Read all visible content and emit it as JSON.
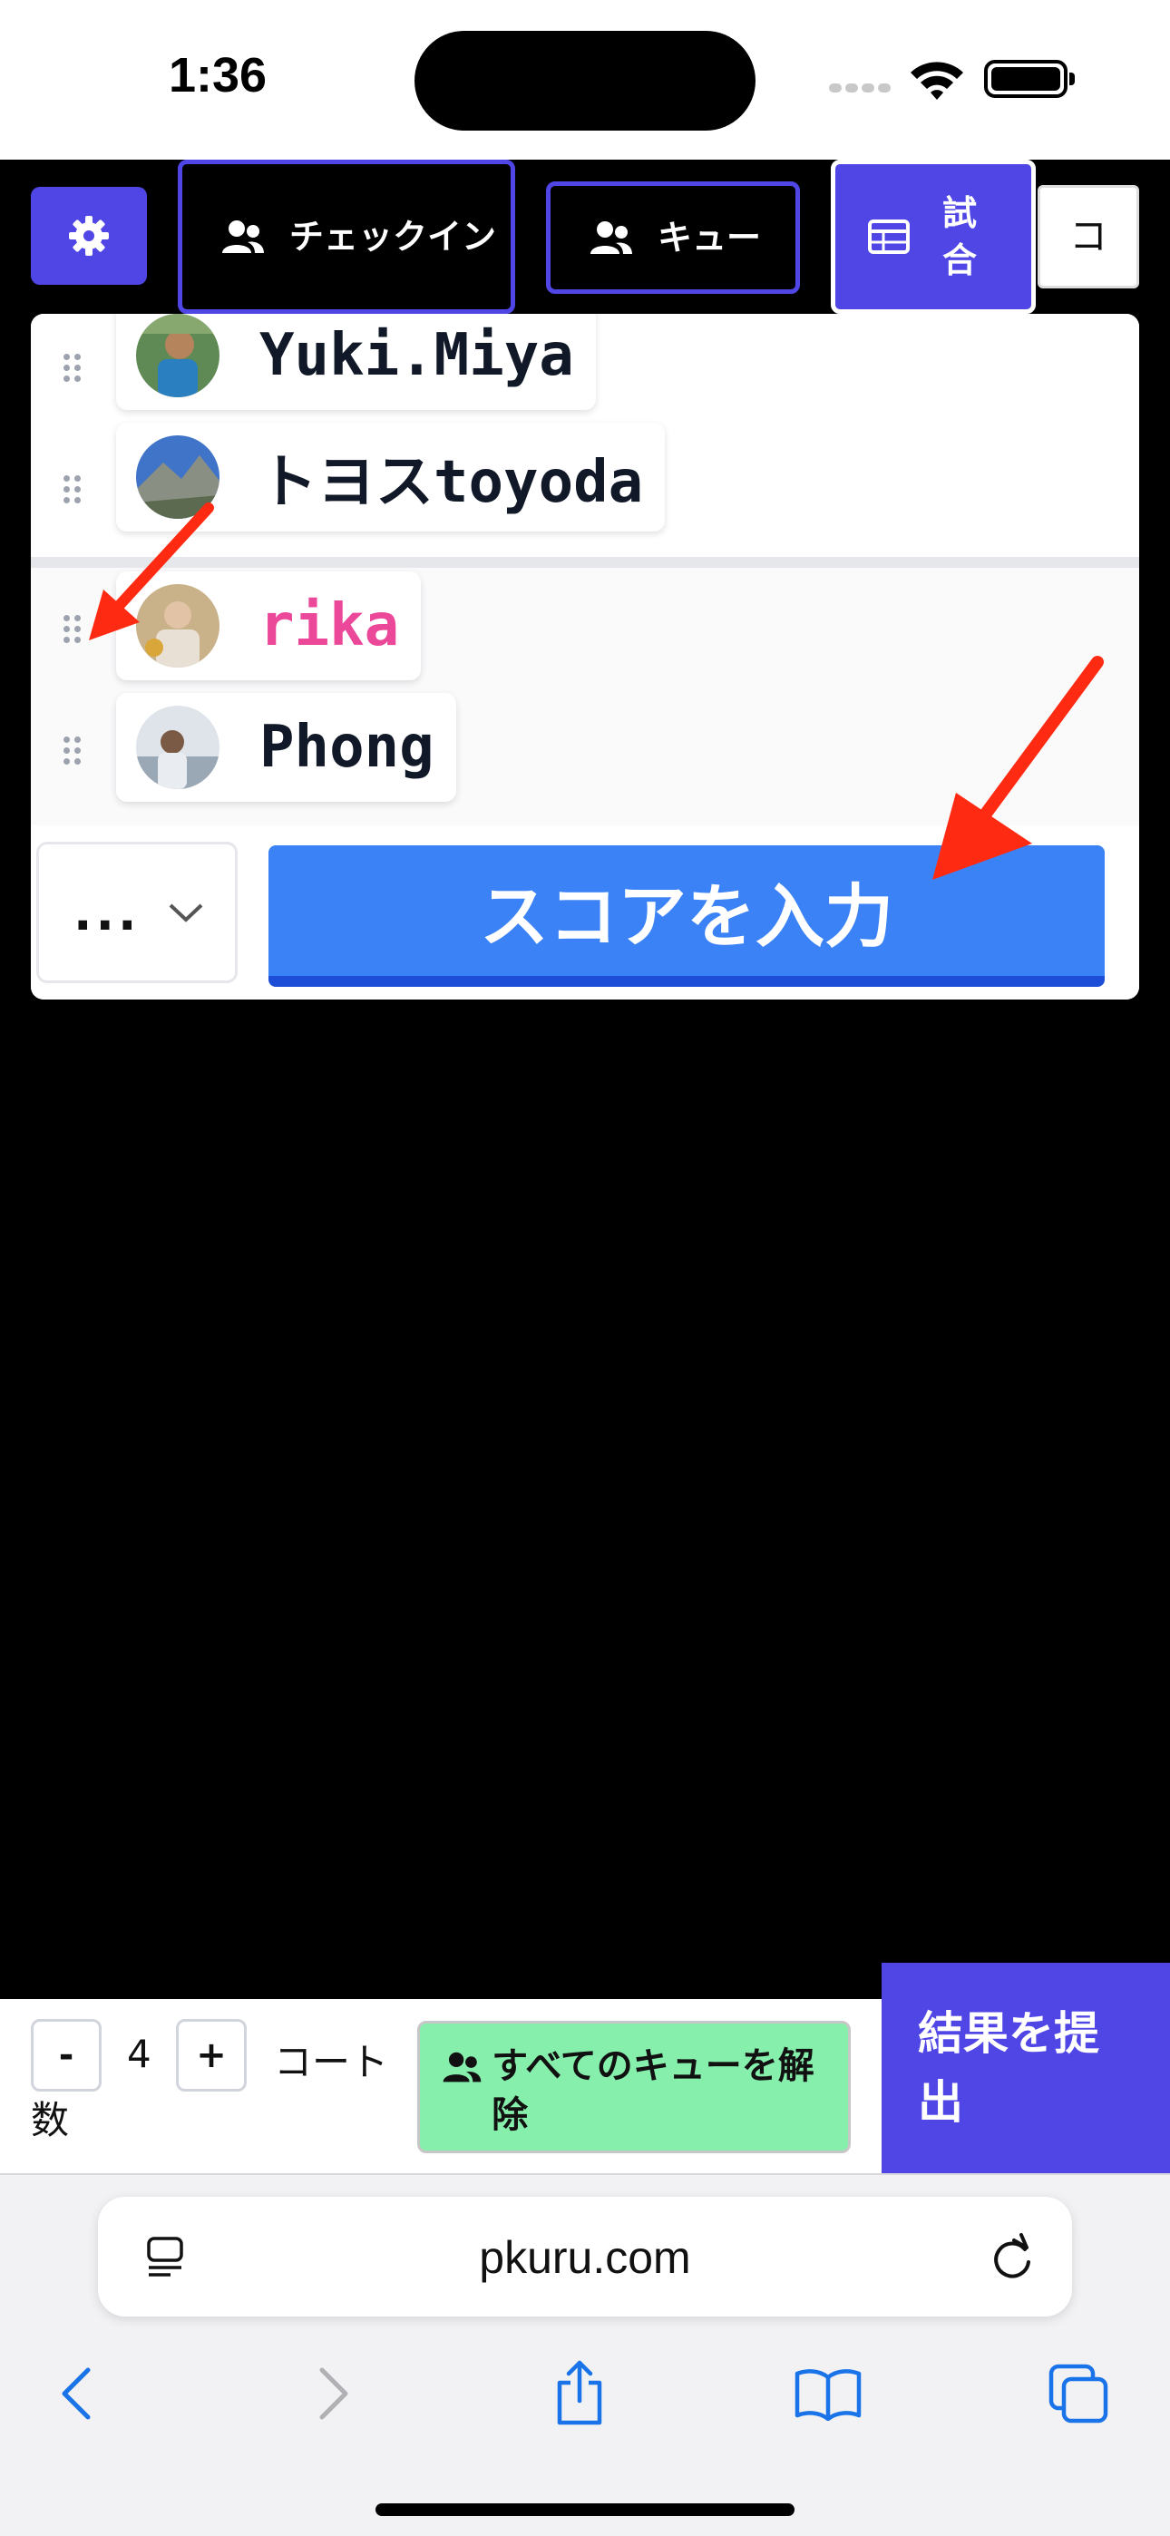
{
  "status_bar": {
    "time": "1:36"
  },
  "tabs": {
    "checkin": "チェックイン",
    "queue": "キュー",
    "match": "試合",
    "court": "コ"
  },
  "match": {
    "team1": [
      {
        "name": "Yuki.Miya"
      },
      {
        "name": "トヨスtoyoda"
      }
    ],
    "team2": [
      {
        "name": "rika"
      },
      {
        "name": "Phong"
      }
    ],
    "more_menu": "...",
    "score_button": "スコアを入力"
  },
  "controls": {
    "minus": "-",
    "court_count": "4",
    "plus": "+",
    "court_label_1": "コート",
    "court_label_2": "数",
    "release_queue": "すべてのキューを解除",
    "submit": "結果を提出"
  },
  "browser": {
    "url": "pkuru.com"
  },
  "colors": {
    "primary": "#4f46e5",
    "score_button": "#3b82f6",
    "release_button": "#86efac",
    "highlight_name": "#ec4899",
    "annotation_arrow": "#ff2a12"
  }
}
